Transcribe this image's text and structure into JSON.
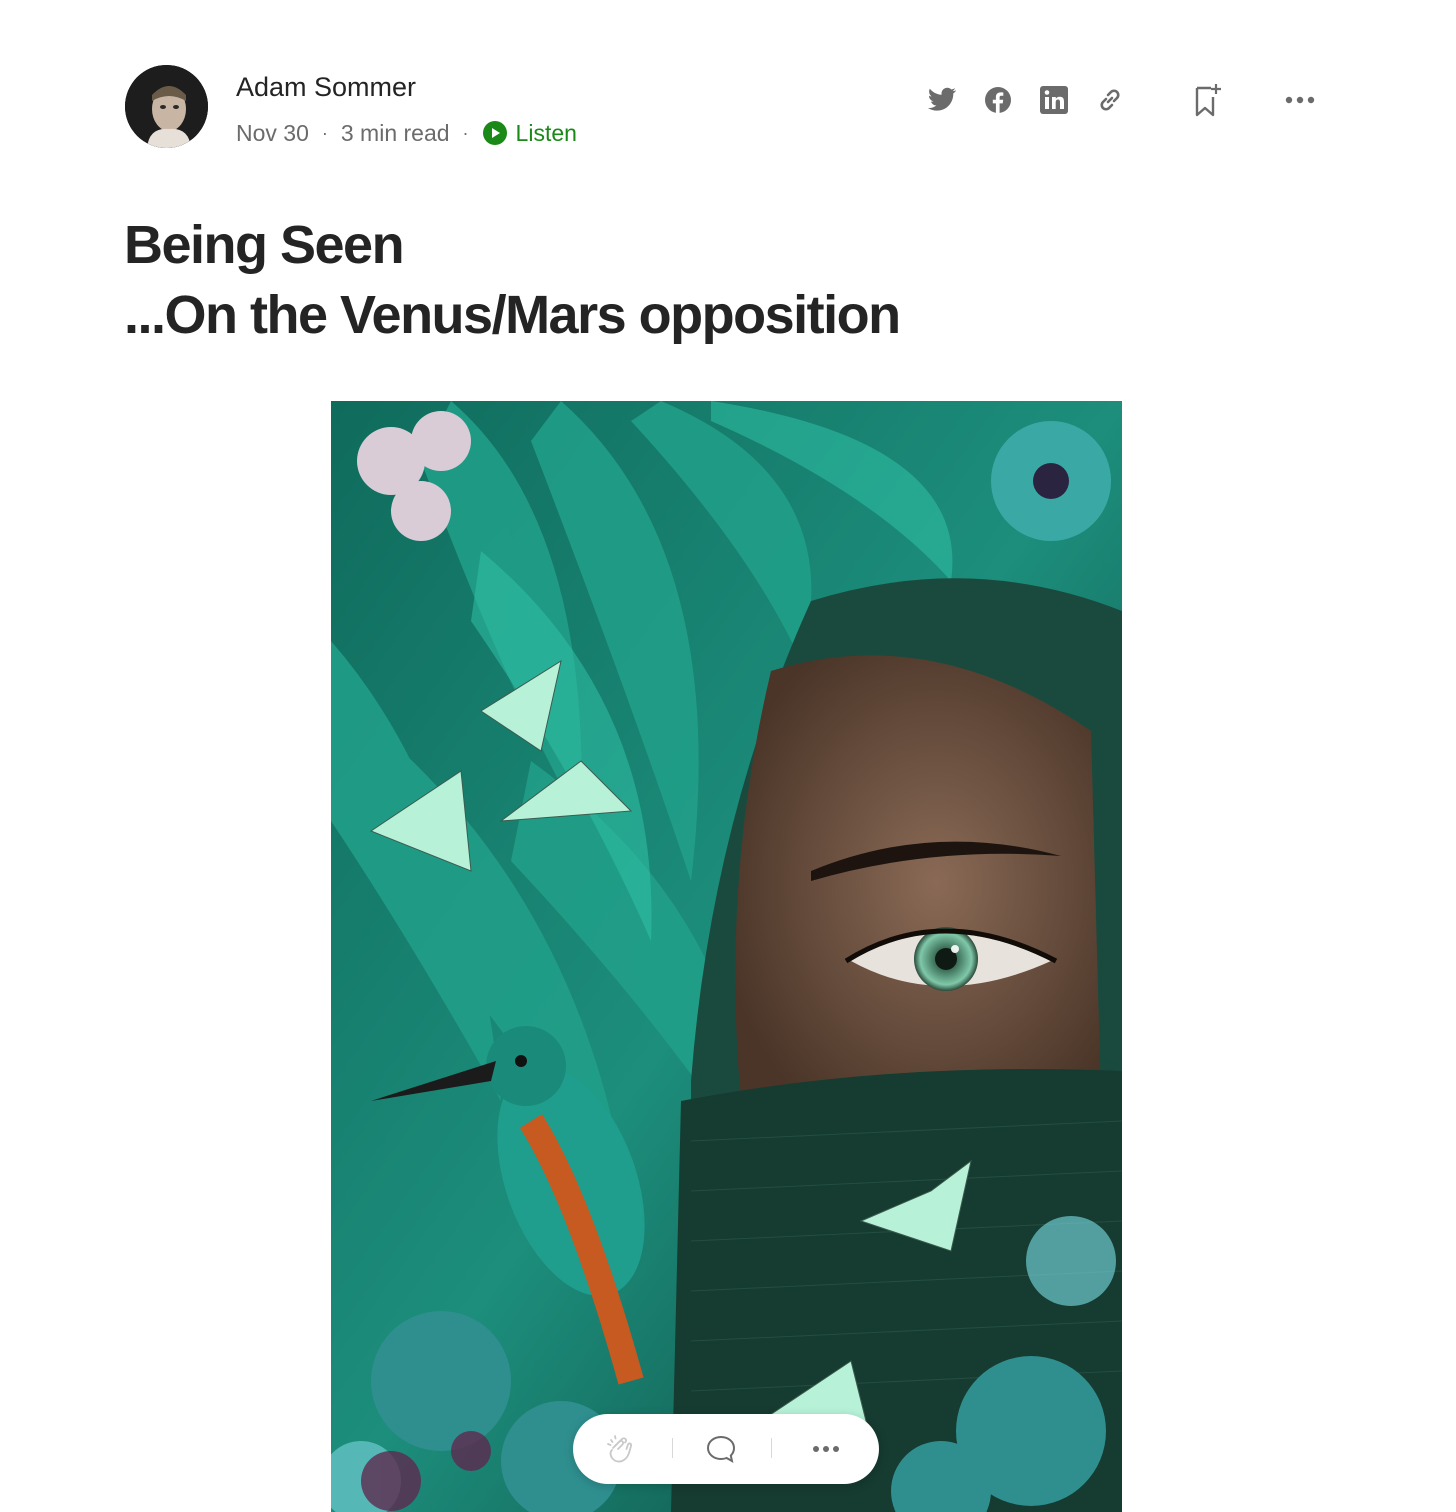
{
  "author": {
    "name": "Adam Sommer",
    "date": "Nov 30",
    "read_time": "3 min read",
    "separator": "·",
    "listen_label": "Listen"
  },
  "share_actions": [
    {
      "icon": "twitter-icon"
    },
    {
      "icon": "facebook-icon"
    },
    {
      "icon": "linkedin-icon"
    },
    {
      "icon": "link-icon"
    }
  ],
  "toolbar": {
    "bookmark_icon": "bookmark-add-icon",
    "more_icon": "more-horizontal-icon"
  },
  "article": {
    "title_line1": "Being Seen",
    "title_line2": "...On the Venus/Mars opposition"
  },
  "floating_bar": {
    "clap_icon": "clap-icon",
    "comment_icon": "comment-icon",
    "more_icon": "more-horizontal-icon"
  },
  "colors": {
    "text": "#242424",
    "muted": "#6b6b6b",
    "accent_green": "#1a8917",
    "icon_gray": "#6b6b6b"
  }
}
